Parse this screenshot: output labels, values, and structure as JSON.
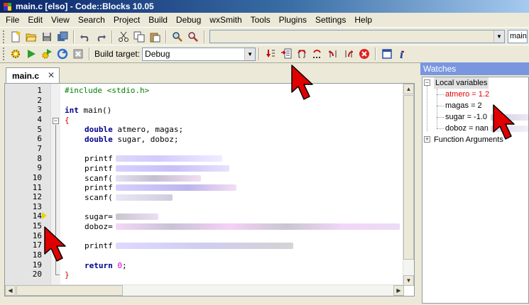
{
  "window": {
    "title": "main.c [elso] - Code::Blocks 10.05"
  },
  "menu": [
    "File",
    "Edit",
    "View",
    "Search",
    "Project",
    "Build",
    "Debug",
    "wxSmith",
    "Tools",
    "Plugins",
    "Settings",
    "Help"
  ],
  "toolbar": {
    "search_combo_value": "main"
  },
  "build": {
    "label": "Build target:",
    "target": "Debug"
  },
  "editor": {
    "tab": "main.c",
    "tab_close": "✕",
    "line_numbers": [
      "1",
      "2",
      "3",
      "4",
      "5",
      "6",
      "7",
      "8",
      "9",
      "10",
      "11",
      "12",
      "13",
      "14",
      "15",
      "16",
      "17",
      "18",
      "19",
      "20"
    ],
    "code": {
      "l1": "#include <stdio.h>",
      "l3_kw": "int",
      "l3_rest": " main()",
      "l4": "{",
      "l5_kw": "double",
      "l5_rest": " atmero, magas;",
      "l6_kw": "double",
      "l6_rest": " sugar, doboz;",
      "l8": "printf",
      "l9": "printf",
      "l10": "scanf(",
      "l11": "printf",
      "l12": "scanf(",
      "l14": "sugar=",
      "l15": "doboz=",
      "l17": "printf",
      "l19_kw": "return",
      "l19_num": "0",
      "l19_end": ";",
      "l20": "}"
    }
  },
  "watches": {
    "title": "Watches",
    "local_variables": "Local variables",
    "items": [
      "atmero = 1.2",
      "magas = 2",
      "sugar = -1.0",
      "doboz = nan"
    ],
    "function_arguments": "Function Arguments"
  },
  "colors": {
    "pointer": "#e00000",
    "title_bar": "#0a246a",
    "watches_header": "#7a96df"
  }
}
